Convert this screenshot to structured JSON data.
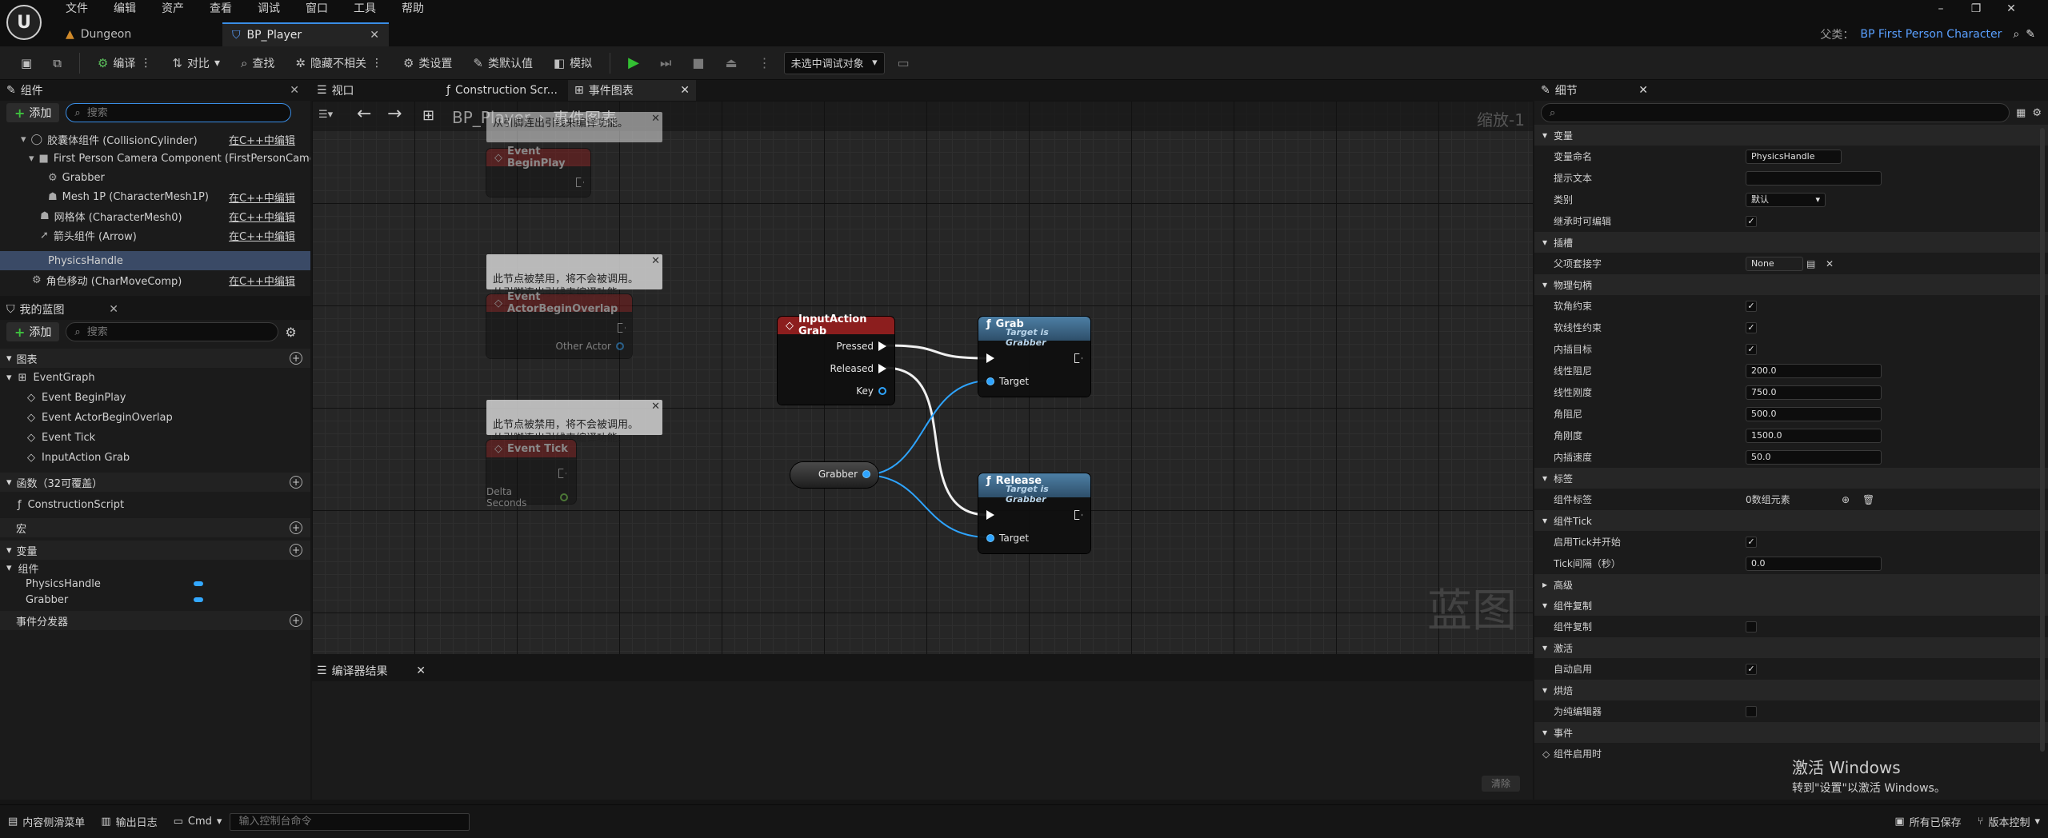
{
  "menu": [
    "文件",
    "编辑",
    "资产",
    "查看",
    "调试",
    "窗口",
    "工具",
    "帮助"
  ],
  "tabs": [
    {
      "label": "Dungeon"
    },
    {
      "label": "BP_Player"
    }
  ],
  "parent": {
    "label": "父类：",
    "value": "BP First Person Character"
  },
  "toolbar": {
    "compile": "编译",
    "diff": "对比",
    "find": "查找",
    "hide_unrelated": "隐藏不相关",
    "class_settings": "类设置",
    "class_defaults": "类默认值",
    "simulate": "模拟",
    "debug_target": "未选中调试对象"
  },
  "components_panel": {
    "title": "组件",
    "add": "添加",
    "search_placeholder": "搜索",
    "items": [
      {
        "label": "胶囊体组件 (CollisionCylinder)",
        "link": "在C++中编辑"
      },
      {
        "label": "First Person Camera Component (FirstPersonCamera)",
        "link": ""
      },
      {
        "label": "Grabber",
        "link": ""
      },
      {
        "label": "Mesh 1P (CharacterMesh1P)",
        "link": "在C++中编辑"
      },
      {
        "label": "网格体 (CharacterMesh0)",
        "link": "在C++中编辑"
      },
      {
        "label": "箭头组件 (Arrow)",
        "link": "在C++中编辑"
      },
      {
        "label": "PhysicsHandle",
        "link": ""
      },
      {
        "label": "角色移动 (CharMoveComp)",
        "link": "在C++中编辑"
      }
    ]
  },
  "my_blueprint": {
    "title": "我的蓝图",
    "add": "添加",
    "search_placeholder": "搜索",
    "graphs_label": "图表",
    "event_graph": "EventGraph",
    "events": [
      "Event BeginPlay",
      "Event ActorBeginOverlap",
      "Event Tick",
      "InputAction Grab"
    ],
    "functions_label": "函数（32可覆盖）",
    "construction_script": "ConstructionScript",
    "macros_label": "宏",
    "variables_label": "变量",
    "components_label": "组件",
    "variables": [
      "PhysicsHandle",
      "Grabber"
    ],
    "dispatchers_label": "事件分发器"
  },
  "graph": {
    "tabs": [
      {
        "label": "视口"
      },
      {
        "label": "Construction Scr..."
      },
      {
        "label": "事件图表"
      }
    ],
    "breadcrumb": [
      "BP_Player",
      "事件图表"
    ],
    "zoom": "缩放-1",
    "watermark": "蓝图",
    "comment_text": "此节点被禁用，将不会被调用。\n从引脚连出引线来编译功能。",
    "comment_partial": "从引脚连出引线来编译功能。",
    "nodes": {
      "begin_play": "Event BeginPlay",
      "actor_overlap": "Event ActorBeginOverlap",
      "other_actor": "Other Actor",
      "tick": "Event Tick",
      "delta_seconds": "Delta Seconds",
      "input_grab": "InputAction Grab",
      "pressed": "Pressed",
      "released": "Released",
      "key": "Key",
      "grab": "Grab",
      "release": "Release",
      "target_is": "Target is Grabber",
      "target": "Target",
      "grabber_var": "Grabber"
    },
    "colors": {
      "event_header": "#8c1e1e",
      "function_header": "#3c6c8c",
      "object_pin": "#2ea4ff"
    }
  },
  "compiler": {
    "title": "编译器结果",
    "clear": "清除"
  },
  "details": {
    "title": "细节",
    "search_placeholder": "",
    "sections": {
      "variable": "变量",
      "socket": "插槽",
      "physics": "物理句柄",
      "tags": "标签",
      "tick": "组件Tick",
      "advanced": "高级",
      "replication": "组件复制",
      "activation": "激活",
      "cooking": "烘焙",
      "events": "事件"
    },
    "var_name_label": "变量命名",
    "var_name": "PhysicsHandle",
    "tooltip_label": "提示文本",
    "tooltip": "",
    "category_label": "类别",
    "category": "默认",
    "editable_label": "继承时可编辑",
    "parent_socket_label": "父项套接字",
    "parent_socket": "None",
    "soft_angular_label": "软角约束",
    "soft_linear_label": "软线性约束",
    "interp_target_label": "内插目标",
    "linear_damping_label": "线性阻尼",
    "linear_damping": "200.0",
    "linear_stiffness_label": "线性刚度",
    "linear_stiffness": "750.0",
    "angular_damping_label": "角阻尼",
    "angular_damping": "500.0",
    "angular_stiffness_label": "角刚度",
    "angular_stiffness": "1500.0",
    "interp_speed_label": "内插速度",
    "interp_speed": "50.0",
    "component_tags_label": "组件标签",
    "component_tags": "0数组元素",
    "start_tick_label": "启用Tick并开始",
    "tick_interval_label": "Tick间隔（秒）",
    "tick_interval": "0.0",
    "replicates_label": "组件复制",
    "auto_activate_label": "自动启用",
    "editor_only_label": "为纯编辑器",
    "on_activated_label": "组件启用时"
  },
  "statusbar": {
    "content_drawer": "内容侧滑菜单",
    "output_log": "输出日志",
    "cmd": "Cmd",
    "console_placeholder": "输入控制台命令",
    "saved": "所有已保存",
    "source_control": "版本控制"
  },
  "windows_activation": {
    "title": "激活 Windows",
    "subtitle": "转到\"设置\"以激活 Windows。"
  }
}
